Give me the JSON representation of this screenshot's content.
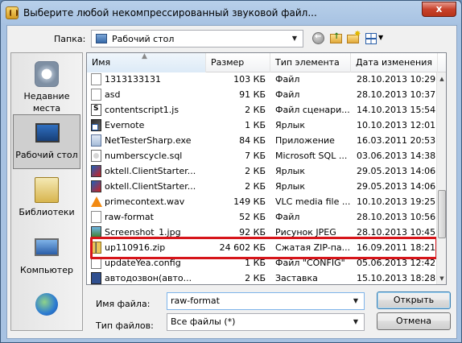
{
  "window": {
    "title": "Выберите любой некомпрессированный звуковой файл...",
    "close_label": "x"
  },
  "lookin": {
    "label": "Папка:",
    "value": "Рабочий стол"
  },
  "places": [
    {
      "label": "Недавние места",
      "icon": "recent-places-icon"
    },
    {
      "label": "Рабочий стол",
      "icon": "desktop-icon",
      "selected": true
    },
    {
      "label": "Библиотеки",
      "icon": "libraries-icon"
    },
    {
      "label": "Компьютер",
      "icon": "computer-icon"
    },
    {
      "label": "",
      "icon": "network-icon"
    }
  ],
  "columns": [
    "Имя",
    "Размер",
    "Тип элемента",
    "Дата изменения"
  ],
  "files": [
    {
      "name": "1313133131",
      "size": "103 КБ",
      "type": "Файл",
      "date": "28.10.2013 10:29",
      "icon": "file"
    },
    {
      "name": "asd",
      "size": "91 КБ",
      "type": "Файл",
      "date": "28.10.2013 10:37",
      "icon": "file"
    },
    {
      "name": "contentscript1.js",
      "size": "2 КБ",
      "type": "Файл сценари...",
      "date": "14.10.2013 15:54",
      "icon": "js"
    },
    {
      "name": "Evernote",
      "size": "1 КБ",
      "type": "Ярлык",
      "date": "10.10.2013 12:01",
      "icon": "shortcut"
    },
    {
      "name": "NetTesterSharp.exe",
      "size": "84 КБ",
      "type": "Приложение",
      "date": "16.03.2011 20:53",
      "icon": "exe"
    },
    {
      "name": "numberscycle.sql",
      "size": "7 КБ",
      "type": "Microsoft SQL ...",
      "date": "03.06.2013 14:38",
      "icon": "sql"
    },
    {
      "name": "oktell.ClientStarter...",
      "size": "2 КБ",
      "type": "Ярлык",
      "date": "29.05.2013 14:06",
      "icon": "oktell"
    },
    {
      "name": "oktell.ClientStarter...",
      "size": "2 КБ",
      "type": "Ярлык",
      "date": "29.05.2013 14:06",
      "icon": "oktell"
    },
    {
      "name": "primecontext.wav",
      "size": "149 КБ",
      "type": "VLC media file ...",
      "date": "10.10.2013 19:25",
      "icon": "vlc"
    },
    {
      "name": "raw-format",
      "size": "52 КБ",
      "type": "Файл",
      "date": "28.10.2013 10:56",
      "icon": "file",
      "highlighted": true
    },
    {
      "name": "Screenshot_1.jpg",
      "size": "92 КБ",
      "type": "Рисунок JPEG",
      "date": "28.10.2013 10:45",
      "icon": "jpg"
    },
    {
      "name": "up110916.zip",
      "size": "24 602 КБ",
      "type": "Сжатая ZIP-па...",
      "date": "16.09.2011 18:21",
      "icon": "zip"
    },
    {
      "name": "updateYea.config",
      "size": "1 КБ",
      "type": "Файл \"CONFIG\"",
      "date": "05.06.2013 12:42",
      "icon": "config"
    },
    {
      "name": "автодозвон(авто...",
      "size": "2 КБ",
      "type": "Заставка",
      "date": "15.10.2013 18:28",
      "icon": "lnk2"
    }
  ],
  "filename": {
    "label": "Имя файла:",
    "value": "raw-format"
  },
  "filetype": {
    "label": "Тип файлов:",
    "value": "Все файлы (*)"
  },
  "buttons": {
    "open": "Открыть",
    "cancel": "Отмена"
  }
}
